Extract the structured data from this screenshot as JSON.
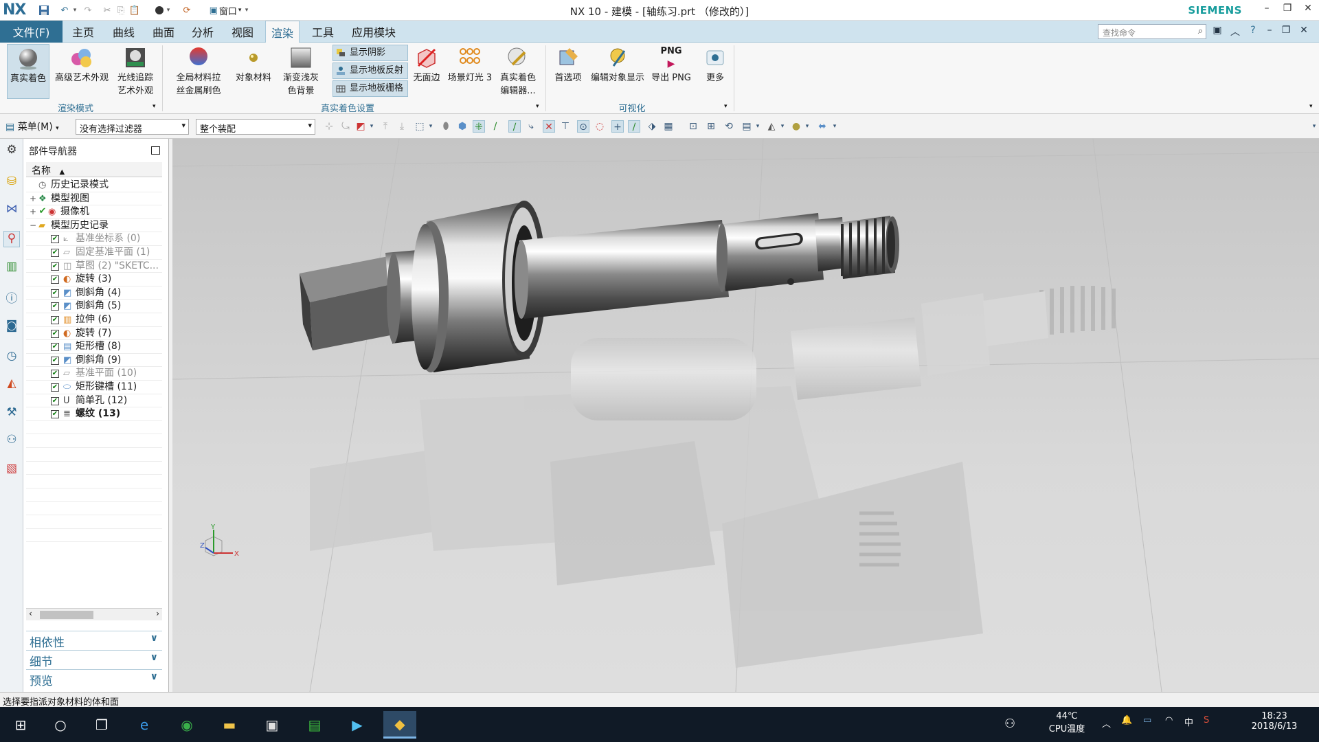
{
  "app": {
    "logo": "NX",
    "window_title": "NX 10 - 建模 - [轴练习.prt （修改的）]",
    "brand": "SIEMENS",
    "quick_window": "窗口"
  },
  "menu": {
    "file": "文件(F)",
    "tabs": [
      "主页",
      "曲线",
      "曲面",
      "分析",
      "视图",
      "渲染",
      "工具",
      "应用模块"
    ],
    "active_tab": "渲染",
    "search_placeholder": "查找命令"
  },
  "ribbon": {
    "render_mode": {
      "buttons": [
        "真实着色",
        "高级艺术外观",
        "光线追踪\n艺术外观"
      ],
      "label": "渲染模式"
    },
    "shading_settings": {
      "buttons": [
        "全局材料拉\n丝金属刷色",
        "对象材料",
        "渐变浅灰\n色背景"
      ],
      "toggles": [
        "显示阴影",
        "显示地板反射",
        "显示地板栅格"
      ],
      "more_buttons": [
        "无面边",
        "场景灯光 3",
        "真实着色\n编辑器..."
      ],
      "label": "真实着色设置"
    },
    "visualization": {
      "buttons": [
        "首选项",
        "编辑对象显示",
        "导出 PNG",
        "更多"
      ],
      "png_text": "PNG",
      "label": "可视化"
    }
  },
  "toolbar": {
    "menu_label": "菜单(M)",
    "filter": "没有选择过滤器",
    "scope": "整个装配"
  },
  "navigator": {
    "title": "部件导航器",
    "column": "名称",
    "items": [
      {
        "label": "历史记录模式",
        "level": 0,
        "expander": "",
        "check": false,
        "icon": "clock-icon",
        "dim": false,
        "bold": false
      },
      {
        "label": "模型视图",
        "level": 0,
        "expander": "+",
        "check": false,
        "icon": "model-view-icon",
        "dim": false,
        "bold": false
      },
      {
        "label": "摄像机",
        "level": 0,
        "expander": "+",
        "check": true,
        "icon": "camera-icon",
        "dim": false,
        "bold": false
      },
      {
        "label": "模型历史记录",
        "level": 0,
        "expander": "−",
        "check": false,
        "icon": "folder-icon",
        "dim": false,
        "bold": false
      },
      {
        "label": "基准坐标系 (0)",
        "level": 1,
        "expander": "",
        "check": true,
        "icon": "datum-csys-icon",
        "dim": true,
        "bold": false
      },
      {
        "label": "固定基准平面 (1)",
        "level": 1,
        "expander": "",
        "check": true,
        "icon": "datum-plane-icon",
        "dim": true,
        "bold": false
      },
      {
        "label": "草图 (2) \"SKETC...",
        "level": 1,
        "expander": "",
        "check": true,
        "icon": "sketch-icon",
        "dim": true,
        "bold": false
      },
      {
        "label": "旋转 (3)",
        "level": 1,
        "expander": "",
        "check": true,
        "icon": "revolve-icon",
        "dim": false,
        "bold": false
      },
      {
        "label": "倒斜角 (4)",
        "level": 1,
        "expander": "",
        "check": true,
        "icon": "chamfer-icon",
        "dim": false,
        "bold": false
      },
      {
        "label": "倒斜角 (5)",
        "level": 1,
        "expander": "",
        "check": true,
        "icon": "chamfer-icon",
        "dim": false,
        "bold": false
      },
      {
        "label": "拉伸 (6)",
        "level": 1,
        "expander": "",
        "check": true,
        "icon": "extrude-icon",
        "dim": false,
        "bold": false
      },
      {
        "label": "旋转 (7)",
        "level": 1,
        "expander": "",
        "check": true,
        "icon": "revolve-icon",
        "dim": false,
        "bold": false
      },
      {
        "label": "矩形槽 (8)",
        "level": 1,
        "expander": "",
        "check": true,
        "icon": "groove-icon",
        "dim": false,
        "bold": false
      },
      {
        "label": "倒斜角 (9)",
        "level": 1,
        "expander": "",
        "check": true,
        "icon": "chamfer-icon",
        "dim": false,
        "bold": false
      },
      {
        "label": "基准平面 (10)",
        "level": 1,
        "expander": "",
        "check": true,
        "icon": "datum-plane-icon",
        "dim": true,
        "bold": false
      },
      {
        "label": "矩形键槽 (11)",
        "level": 1,
        "expander": "",
        "check": true,
        "icon": "slot-icon",
        "dim": false,
        "bold": false
      },
      {
        "label": "简单孔 (12)",
        "level": 1,
        "expander": "",
        "check": true,
        "icon": "hole-icon",
        "dim": false,
        "bold": false
      },
      {
        "label": "螺纹 (13)",
        "level": 1,
        "expander": "",
        "check": true,
        "icon": "thread-icon",
        "dim": false,
        "bold": true
      }
    ],
    "panels": [
      "相依性",
      "细节",
      "预览"
    ]
  },
  "viewport": {
    "triad_x": "X",
    "triad_y": "Y",
    "triad_z": "Z"
  },
  "status": {
    "message": "选择要指派对象材料的体和面"
  },
  "taskbar": {
    "temp": "44℃",
    "temp_label": "CPU温度",
    "ime": "中",
    "time": "18:23",
    "date": "2018/6/13"
  },
  "colors": {
    "accent": "#2f6f93",
    "tab_bar": "#cfe3ee",
    "brand": "#169c9c",
    "taskbar": "#101a26"
  }
}
